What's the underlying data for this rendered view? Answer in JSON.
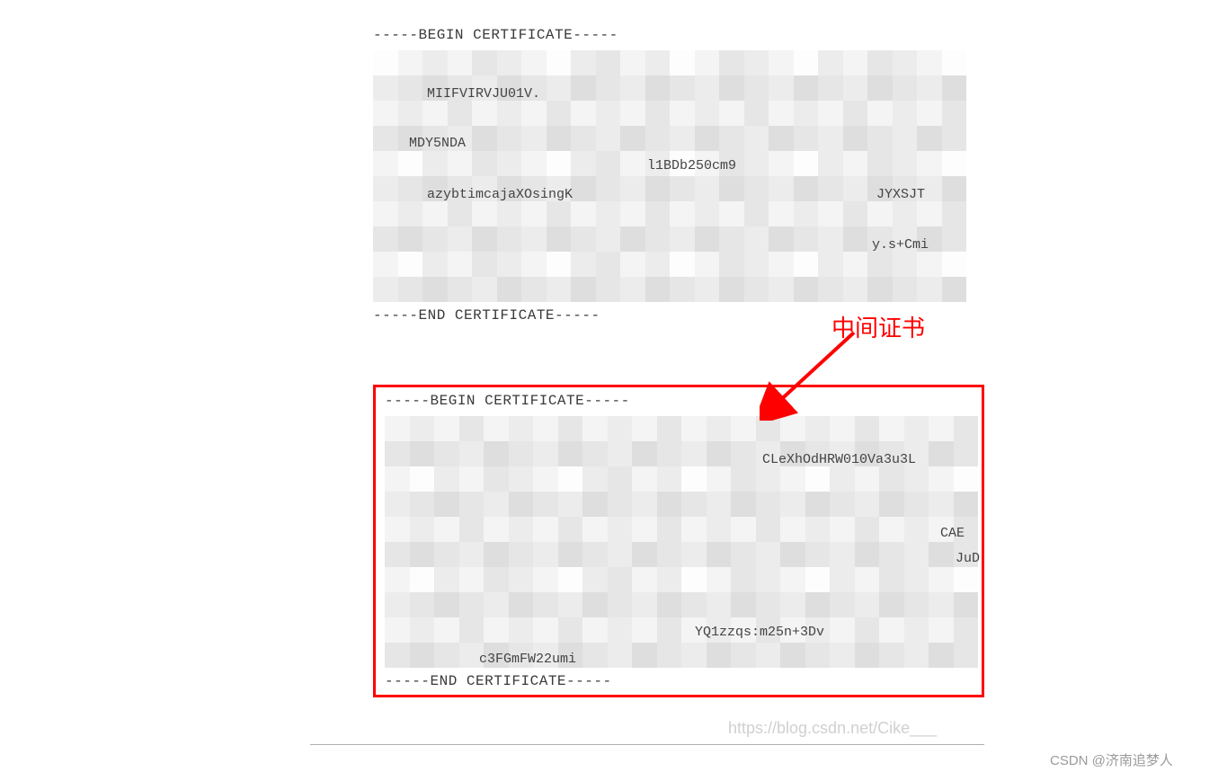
{
  "annotation": {
    "label": "中间证书"
  },
  "cert1": {
    "begin": "-----BEGIN CERTIFICATE-----",
    "end": "-----END CERTIFICATE-----",
    "fragments": {
      "f1": "MIIFVIRVJU01V.",
      "f2": "MDY5NDA",
      "f3": "l1BDb250cm9",
      "f4": "azybtimcajaXOsingK",
      "f5": "JYXSJT",
      "f6": "y.s+Cmi"
    }
  },
  "cert2": {
    "begin": "-----BEGIN CERTIFICATE-----",
    "end": "-----END CERTIFICATE-----",
    "fragments": {
      "f1": "CLeXhOdHRW010Va3u3L",
      "f2": "CAE",
      "f3": "JuD",
      "f4": "YQ1zzqs:m25n+3Dv",
      "f5": "c3FGmFW22umi"
    }
  },
  "watermark": {
    "url": "https://blog.csdn.net/Cike___",
    "csdn": "CSDN @济南追梦人"
  }
}
